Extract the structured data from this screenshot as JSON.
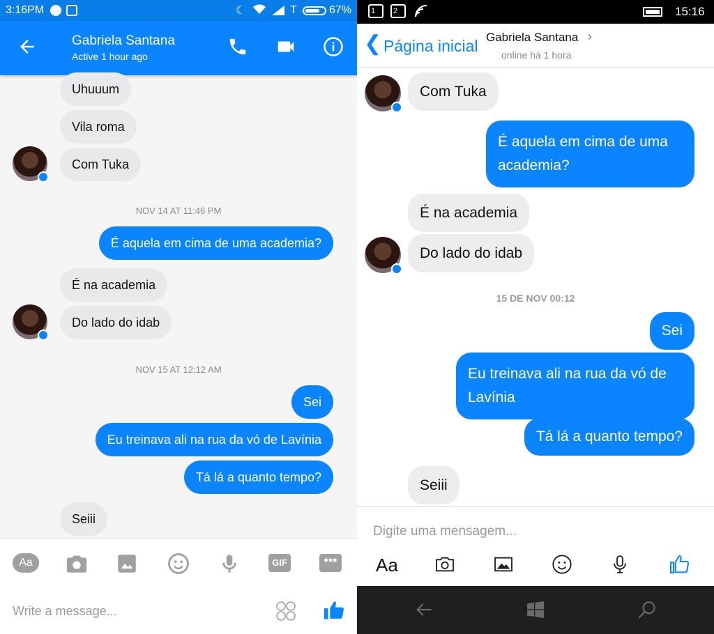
{
  "android": {
    "status": {
      "time": "3:16PM",
      "carrier": "T",
      "battery": "67%"
    },
    "header": {
      "name": "Gabriela Santana",
      "subtitle": "Active 1 hour ago"
    },
    "messages_top": [
      "Uhuuum",
      "Vila roma",
      "Com Tuka"
    ],
    "stamp1": "NOV 14 AT 11:46 PM",
    "sent1": "É aquela em cima de uma academia?",
    "received2": [
      "É na academia",
      "Do lado do idab"
    ],
    "stamp2": "NOV 15 AT 12:12 AM",
    "sent2": [
      "Sei",
      "Eu treinava ali na rua da vó de Lavínia",
      "Tá lá a quanto tempo?"
    ],
    "received3": "Seiii",
    "toolbar": {
      "aa": "Aa",
      "gif": "GIF",
      "more": "•••"
    },
    "compose": {
      "placeholder": "Write a message..."
    }
  },
  "windows": {
    "status": {
      "sim1": "1",
      "sim2": "2",
      "time": "15:16"
    },
    "header": {
      "back_label": "Página inicial",
      "name": "Gabriela Santana",
      "subtitle": "online há 1 hora"
    },
    "received1": "Com Tuka",
    "sent1": "É aquela em cima de uma academia?",
    "received2": [
      "É na academia",
      "Do lado do idab"
    ],
    "stamp": "15 DE NOV 00:12",
    "sent2": [
      "Sei",
      "Eu treinava ali na rua da vó de Lavínia",
      "Tá lá a quanto tempo?"
    ],
    "received3": "Seiii",
    "input": {
      "placeholder": "Digite uma mensagem...",
      "aa": "Aa"
    }
  },
  "colors": {
    "messenger_blue": "#0a84ff",
    "bubble_gray": "#e9e9eb",
    "status_blue": "#0a7ee8"
  }
}
